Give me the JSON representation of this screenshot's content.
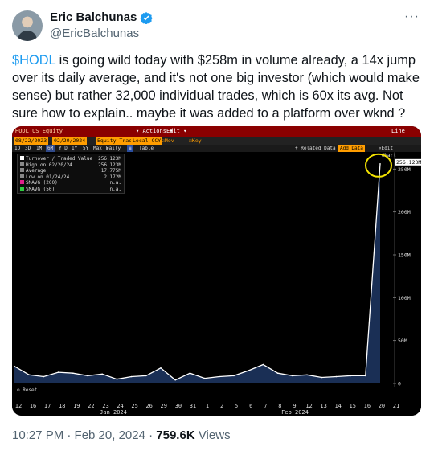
{
  "author": {
    "name": "Eric Balchunas",
    "handle": "@EricBalchunas"
  },
  "menu_label": "···",
  "tweet": {
    "cashtag": "$HODL",
    "text": " is going wild today with $258m in volume already, a 14x jump over its daily average, and it's not one big investor (which would make sense) but rather 32,000 individual trades, which is 60x its avg. Not sure how to explain.. maybe it was added to a platform over wknd ?"
  },
  "terminal": {
    "ticker": "HODL US Equity",
    "actions": "Actions",
    "edit": "Edit",
    "title": "Line Chart",
    "date_from": "08/22/2023",
    "date_to": "02/20/2024",
    "equity_tracker": "Equity Tracker",
    "currency": "Local CCY",
    "mov_avgs": "Mov Avgs",
    "key_events": "Key Events",
    "periods": [
      "1D",
      "3D",
      "1M",
      "6M",
      "YTD",
      "1Y",
      "5Y",
      "Max",
      "Daily"
    ],
    "table": "Table",
    "related_data": "+ Related Data",
    "add_data": "Add Data",
    "edit_chart": "Edit Chart",
    "reset": "Reset"
  },
  "legend": {
    "rows": [
      {
        "label": "Turnover / Traded Value",
        "value": "256.123M",
        "color": "#ffffff"
      },
      {
        "label": "High on 02/20/24",
        "value": "256.123M",
        "color": "#888888"
      },
      {
        "label": "Average",
        "value": "17.775M",
        "color": "#888888"
      },
      {
        "label": "Low on 01/24/24",
        "value": "2.172M",
        "color": "#888888"
      },
      {
        "label": "SMAVG (200)",
        "value": "n.a.",
        "color": "#e0208c"
      },
      {
        "label": "SMAVG (50)",
        "value": "n.a.",
        "color": "#2ecc40"
      }
    ]
  },
  "chart_data": {
    "type": "area",
    "title": "",
    "xlabel": "",
    "ylabel": "",
    "y_ticks": [
      "0",
      "50M",
      "100M",
      "150M",
      "200M",
      "250M"
    ],
    "ylim": [
      0,
      270
    ],
    "last_value_label": "256.123M",
    "x_tick_labels": [
      "12",
      "16",
      "17",
      "18",
      "19",
      "22",
      "23",
      "24",
      "25",
      "26",
      "29",
      "30",
      "31",
      "1",
      "2",
      "5",
      "6",
      "7",
      "8",
      "9",
      "12",
      "13",
      "14",
      "15",
      "16",
      "20",
      "21"
    ],
    "x_month_labels": [
      "Jan 2024",
      "Feb 2024"
    ],
    "series": [
      {
        "values": [
          20,
          10,
          8,
          13,
          12,
          9,
          11,
          5,
          8,
          9,
          18,
          4,
          12,
          6,
          8,
          9,
          15,
          22,
          12,
          9,
          10,
          7,
          8,
          9,
          9,
          256.123
        ]
      }
    ],
    "grid": false,
    "legend_position": "top-left"
  },
  "footer": {
    "time": "10:27 PM · Feb 20, 2024 · ",
    "views_count": "759.6K",
    "views_label": " Views"
  }
}
